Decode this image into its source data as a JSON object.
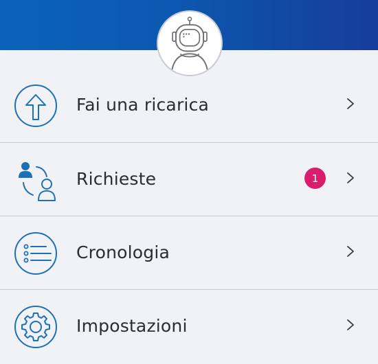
{
  "header": {
    "avatar_icon": "astronaut-avatar-icon"
  },
  "colors": {
    "header_start": "#0a63b8",
    "header_end": "#163d99",
    "icon_blue": "#1b70b8",
    "badge": "#d91c6b",
    "text": "#2a2c31",
    "background": "#f1f2f6"
  },
  "menu": {
    "items": [
      {
        "label": "Fai una ricarica",
        "icon": "upload-arrow-icon"
      },
      {
        "label": "Richieste",
        "icon": "people-request-icon",
        "badge": "1"
      },
      {
        "label": "Cronologia",
        "icon": "history-list-icon"
      },
      {
        "label": "Impostazioni",
        "icon": "settings-gear-icon"
      }
    ]
  }
}
